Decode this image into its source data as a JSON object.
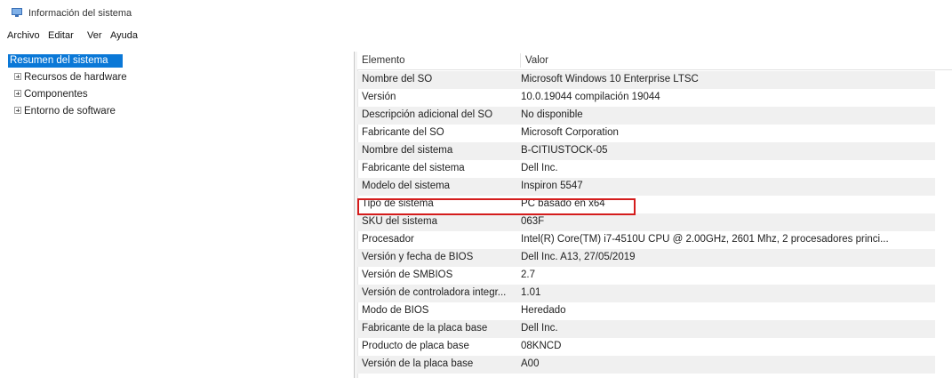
{
  "window": {
    "title": "Información del sistema",
    "icon": "system-information-icon"
  },
  "menu": {
    "items": [
      "Archivo",
      "Editar",
      "Ver",
      "Ayuda"
    ]
  },
  "tree": {
    "root": "Resumen del sistema",
    "children": [
      "Recursos de hardware",
      "Componentes",
      "Entorno de software"
    ]
  },
  "table": {
    "headers": [
      "Elemento",
      "Valor"
    ],
    "rows": [
      [
        "Nombre del SO",
        "Microsoft Windows 10 Enterprise LTSC"
      ],
      [
        "Versión",
        "10.0.19044 compilación 19044"
      ],
      [
        "Descripción adicional del SO",
        "No disponible"
      ],
      [
        "Fabricante del SO",
        "Microsoft Corporation"
      ],
      [
        "Nombre del sistema",
        "B-CITIUSTOCK-05"
      ],
      [
        "Fabricante del sistema",
        "Dell Inc."
      ],
      [
        "Modelo del sistema",
        "Inspiron 5547"
      ],
      [
        "Tipo de sistema",
        "PC basado en x64"
      ],
      [
        "SKU del sistema",
        "063F"
      ],
      [
        "Procesador",
        "Intel(R) Core(TM) i7-4510U CPU @ 2.00GHz, 2601 Mhz, 2 procesadores princi..."
      ],
      [
        "Versión y fecha de BIOS",
        "Dell Inc. A13, 27/05/2019"
      ],
      [
        "Versión de SMBIOS",
        "2.7"
      ],
      [
        "Versión de controladora integr...",
        "1.01"
      ],
      [
        "Modo de BIOS",
        "Heredado"
      ],
      [
        "Fabricante de la placa base",
        "Dell Inc."
      ],
      [
        "Producto de placa base",
        "08KNCD"
      ],
      [
        "Versión de la placa base",
        "A00"
      ]
    ]
  },
  "colors": {
    "selection": "#0a78d7",
    "highlight_border": "#d41c1c",
    "alt_row": "#f0f0f0"
  }
}
